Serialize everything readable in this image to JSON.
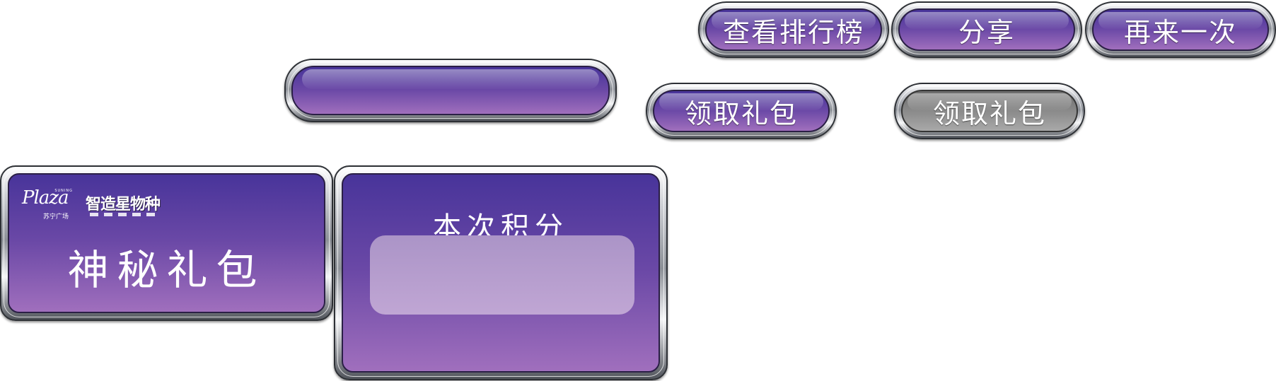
{
  "buttons": {
    "leaderboard": "查看排行榜",
    "share": "分享",
    "play_again": "再来一次",
    "blank_bar": "",
    "claim_gift": "领取礼包",
    "claim_gift_disabled": "领取礼包"
  },
  "gift_panel": {
    "logo_left_script": "Plaza",
    "logo_left_tiny": "SUNING",
    "logo_left_cn": "苏宁广场",
    "logo_right": "智造星物种",
    "title": "神秘礼包"
  },
  "score_panel": {
    "title": "本次积分",
    "score_value": ""
  },
  "colors": {
    "purple_top": "#48349a",
    "purple_bottom": "#a06fbd",
    "disabled_gray": "#8a8a8a",
    "score_box": "#b59dcb"
  }
}
